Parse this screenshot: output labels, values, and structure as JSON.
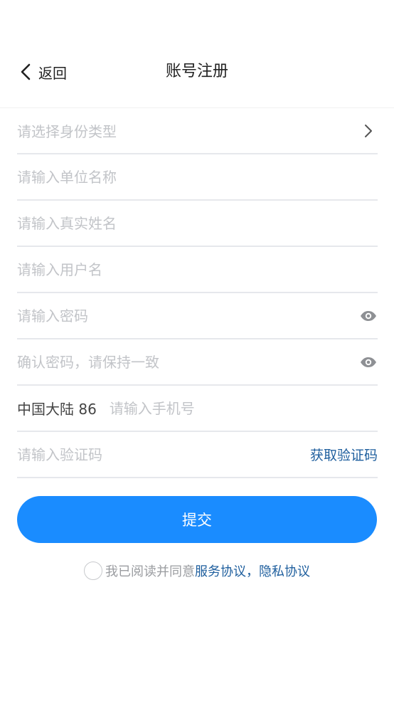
{
  "header": {
    "back_label": "返回",
    "title": "账号注册"
  },
  "form": {
    "identity_type_placeholder": "请选择身份类型",
    "unit_name_placeholder": "请输入单位名称",
    "real_name_placeholder": "请输入真实姓名",
    "username_placeholder": "请输入用户名",
    "password_placeholder": "请输入密码",
    "confirm_password_placeholder": "确认密码，请保持一致",
    "region_code": "中国大陆 86",
    "phone_placeholder": "请输入手机号",
    "code_placeholder": "请输入验证码",
    "get_code_label": "获取验证码"
  },
  "submit": {
    "label": "提交"
  },
  "agreement": {
    "prefix": "我已阅读并同意",
    "service_link": "服务协议",
    "separator": "，",
    "privacy_link": "隐私协议"
  },
  "icons": {
    "back": "chevron-left-icon",
    "select": "chevron-right-icon",
    "password_toggle": "eye-icon"
  },
  "colors": {
    "primary": "#1a8cff",
    "link": "#1f5f9e",
    "placeholder": "#c2c4c8",
    "divider": "#e6e8ec"
  }
}
